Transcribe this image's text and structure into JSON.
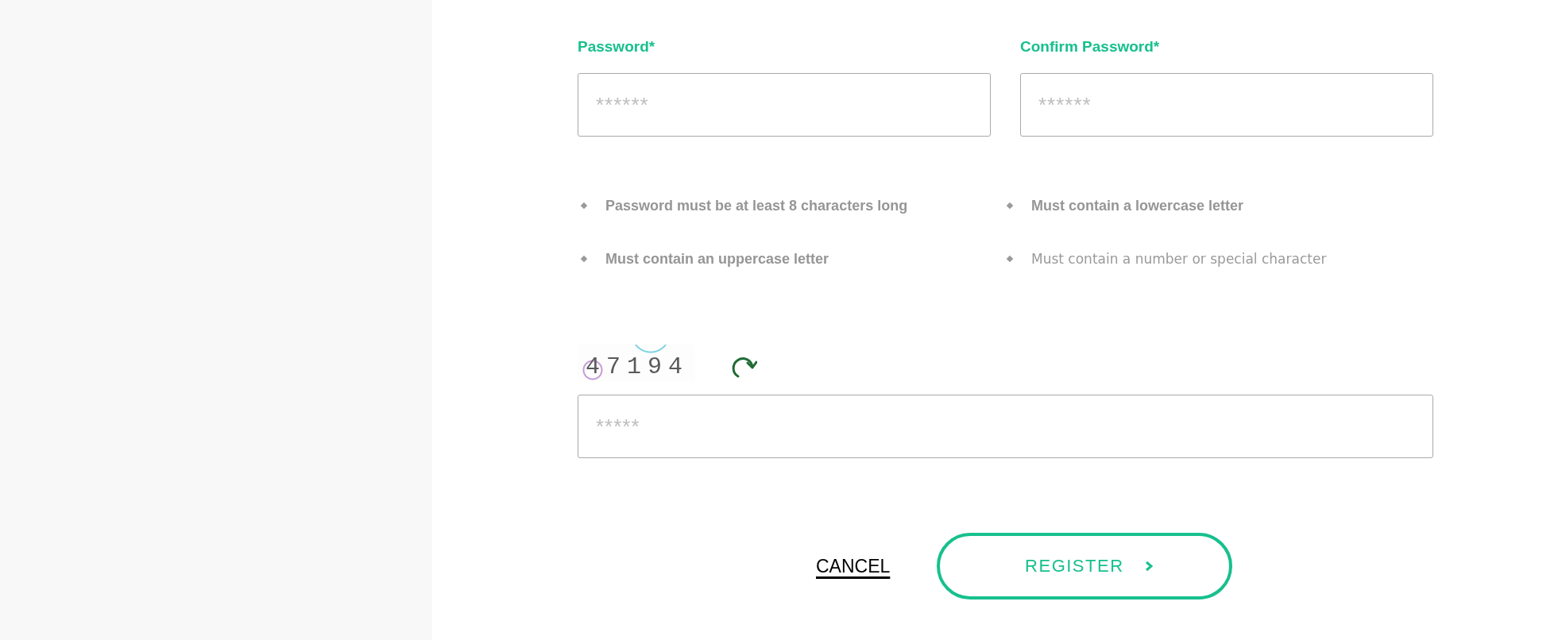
{
  "fields": [
    {
      "label": "Password*",
      "placeholder": "******"
    },
    {
      "label": "Confirm Password*",
      "placeholder": "******"
    }
  ],
  "requirements": [
    {
      "text": "Password must be at least 8 characters long",
      "met": true
    },
    {
      "text": "Must contain a lowercase letter",
      "met": true
    },
    {
      "text": "Must contain an uppercase letter",
      "met": true
    },
    {
      "text": "Must contain a number or special character",
      "met": false
    }
  ],
  "captcha": {
    "code": "47194",
    "placeholder": "*****"
  },
  "buttons": [
    {
      "label": "CANCEL",
      "kind": "link"
    },
    {
      "label": "REGISTER",
      "kind": "primary"
    }
  ]
}
